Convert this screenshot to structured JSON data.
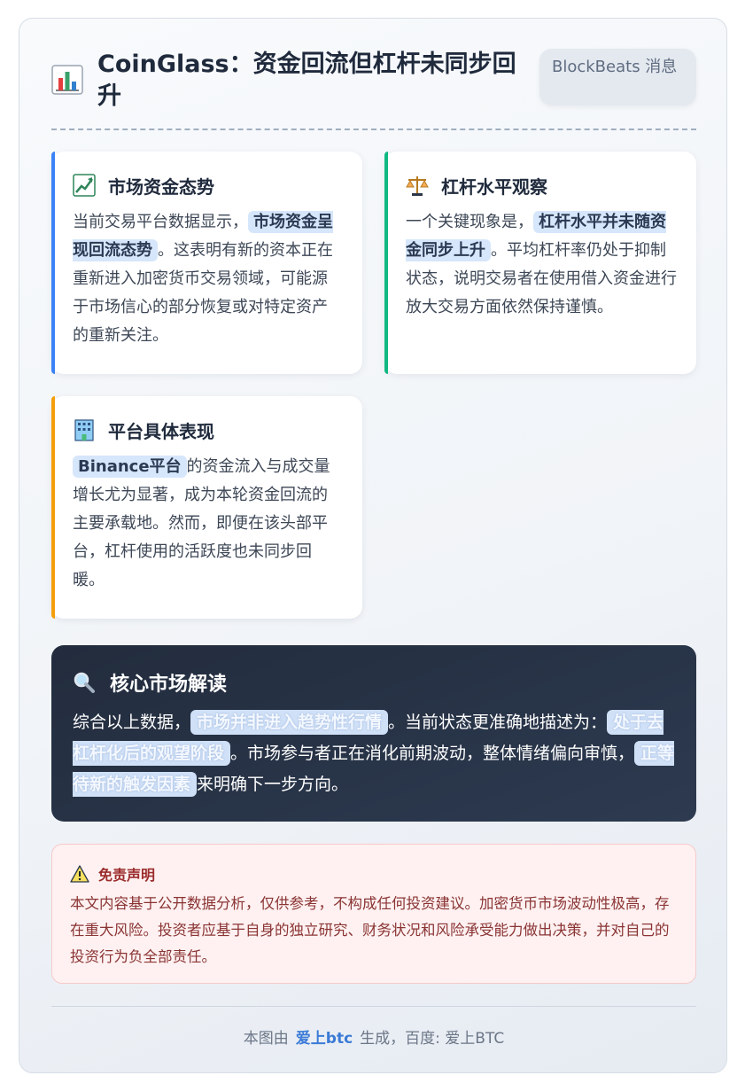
{
  "header": {
    "title": "CoinGlass：资金回流但杠杆未同步回升",
    "source_badge": "BlockBeats 消息",
    "title_icon": "bar-chart-icon"
  },
  "cards": [
    {
      "id": "market",
      "icon": "chart-increasing-icon",
      "heading": "市场资金态势",
      "accent_color": "#3b82f6",
      "body_before": "当前交易平台数据显示，",
      "highlight": "市场资金呈现回流态势",
      "body_after": "。这表明有新的资本正在重新进入加密货币交易领域，可能源于市场信心的部分恢复或对特定资产的重新关注。"
    },
    {
      "id": "leverage",
      "icon": "balance-scale-icon",
      "heading": "杠杆水平观察",
      "accent_color": "#10b981",
      "body_before": "一个关键现象是，",
      "highlight": "杠杆水平并未随资金同步上升",
      "body_after": "。平均杠杆率仍处于抑制状态，说明交易者在使用借入资金进行放大交易方面依然保持谨慎。"
    },
    {
      "id": "platform",
      "icon": "office-building-icon",
      "heading": "平台具体表现",
      "accent_color": "#f59e0b",
      "body_before": "",
      "highlight": "Binance平台",
      "body_after": "的资金流入与成交量增长尤为显著，成为本轮资金回流的主要承载地。然而，即便在该头部平台，杠杆使用的活跃度也未同步回暖。"
    }
  ],
  "insight": {
    "icon": "magnifier-icon",
    "heading": "核心市场解读",
    "part1": "综合以上数据，",
    "hl1": "市场并非进入趋势性行情",
    "part2": "。当前状态更准确地描述为：",
    "hl2": "处于去杠杆化后的观望阶段",
    "part3": "。市场参与者正在消化前期波动，整体情绪偏向审慎，",
    "hl3": "正等待新的触发因素",
    "part4": "来明确下一步方向。"
  },
  "disclaimer": {
    "icon": "warning-icon",
    "heading": "免责声明",
    "text": "本文内容基于公开数据分析，仅供参考，不构成任何投资建议。加密货币市场波动性极高，存在重大风险。投资者应基于自身的独立研究、财务状况和风险承受能力做出决策，并对自己的投资行为负全部责任。"
  },
  "footer": {
    "prefix": "本图由",
    "brand": "爱上btc",
    "suffix": "生成，百度: 爱上BTC"
  }
}
